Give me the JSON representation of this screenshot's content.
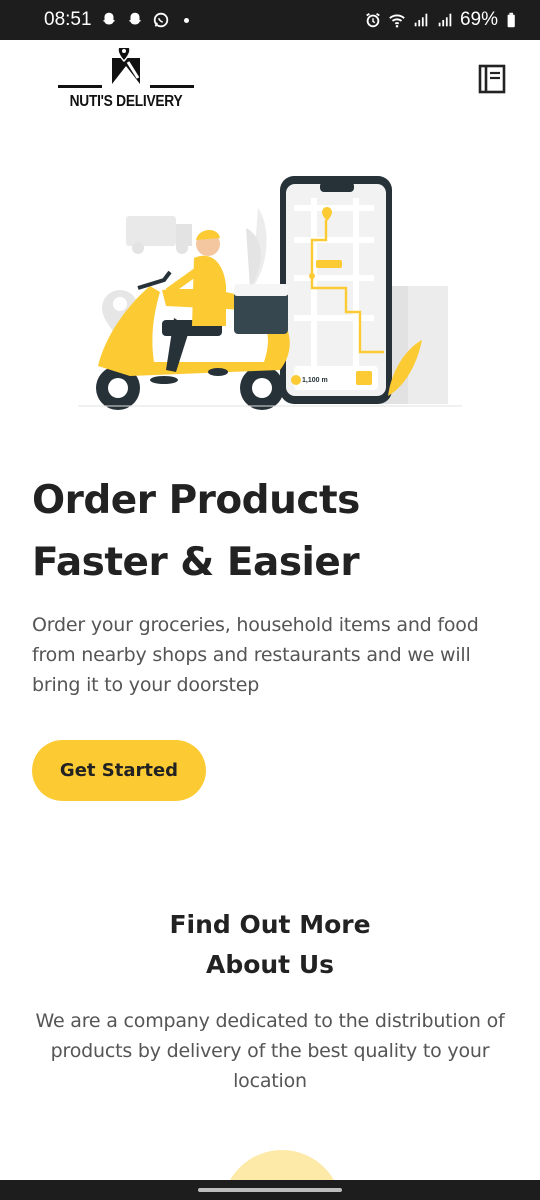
{
  "status_bar": {
    "time": "08:51",
    "battery": "69%",
    "icons": [
      "snapchat-icon",
      "snapchat-icon",
      "whatsapp-icon",
      "alarm-icon",
      "wifi-icon",
      "signal-icon",
      "signal-icon",
      "battery-icon"
    ]
  },
  "header": {
    "brand": "NUTI'S DELIVERY",
    "menu_icon": "notebook-icon"
  },
  "hero": {
    "headline_line1": "Order Products",
    "headline_line2": "Faster & Easier",
    "description": "Order your groceries, household items and food from nearby shops and restaurants and we will bring it to your doorstep",
    "cta_label": "Get Started",
    "illustration_distance": "1,100 m"
  },
  "about": {
    "title_line1": "Find Out More",
    "title_line2": "About Us",
    "description": "We are a company dedicated to the distribution of products by delivery of the best quality to your location"
  },
  "colors": {
    "accent": "#fccb33",
    "text": "#222222",
    "muted": "#555555",
    "status_bar": "#1d1d1d"
  }
}
